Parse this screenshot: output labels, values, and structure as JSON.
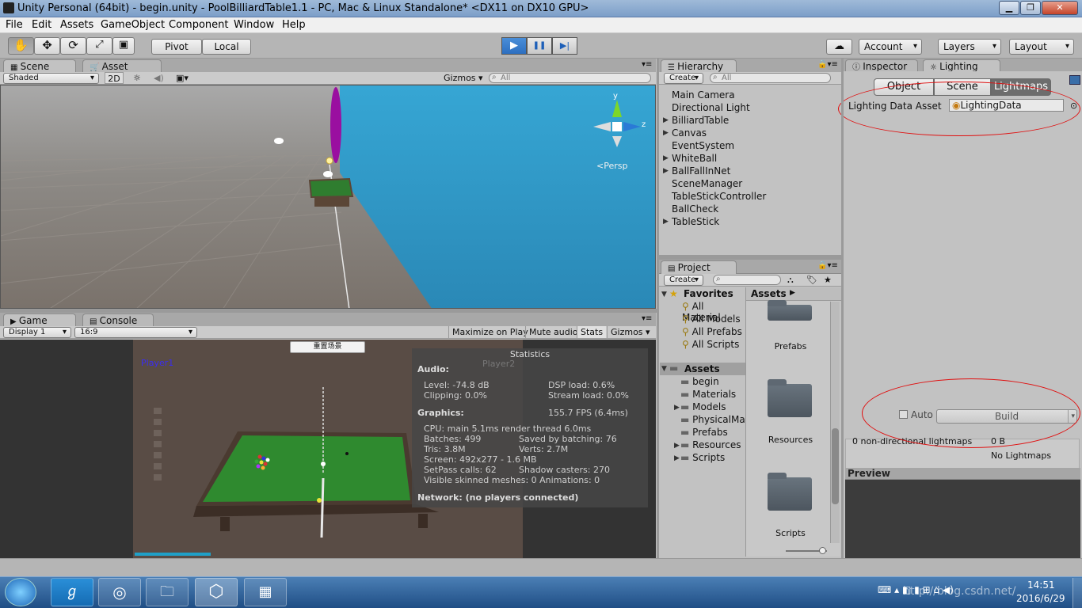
{
  "window": {
    "title": "Unity Personal (64bit) - begin.unity - PoolBilliardTable1.1 - PC, Mac & Linux Standalone* <DX11 on DX10 GPU>",
    "minimize": "▁",
    "maximize": "❐",
    "close": "✕"
  },
  "menu": [
    "File",
    "Edit",
    "Assets",
    "GameObject",
    "Component",
    "Window",
    "Help"
  ],
  "toolbar": {
    "tools": [
      "hand-icon",
      "move-icon",
      "rotate-icon",
      "scale-icon",
      "rect-icon"
    ],
    "pivot": "Pivot",
    "local": "Local",
    "play": "▶",
    "pause": "❚❚",
    "step": "▶|",
    "account": "Account",
    "layers": "Layers",
    "layout": "Layout"
  },
  "scene": {
    "tab": "Scene",
    "asset_store_tab": "Asset Store",
    "shading": "Shaded",
    "mode_2d": "2D",
    "gizmos": "Gizmos",
    "search_placeholder": "All",
    "persp": "Persp",
    "axis_y": "y",
    "axis_z": "z"
  },
  "game": {
    "tab": "Game",
    "console_tab": "Console",
    "display": "Display 1",
    "aspect": "16:9",
    "maximize_on_play": "Maximize on Play",
    "mute_audio": "Mute audio",
    "stats": "Stats",
    "gizmos": "Gizmos",
    "reset_button": "重置场景",
    "player1": "Player1",
    "player2": "Player2"
  },
  "statistics": {
    "title": "Statistics",
    "audio_label": "Audio:",
    "level": "Level: -74.8 dB",
    "clipping": "Clipping: 0.0%",
    "dsp_load": "DSP load: 0.6%",
    "stream_load": "Stream load: 0.0%",
    "graphics_label": "Graphics:",
    "fps": "155.7 FPS (6.4ms)",
    "cpu": "CPU: main 5.1ms  render thread 6.0ms",
    "batches": "Batches: 499",
    "saved_batching": "Saved by batching: 76",
    "tris": "Tris: 3.8M",
    "verts": "Verts: 2.7M",
    "screen": "Screen: 492x277 - 1.6 MB",
    "setpass": "SetPass calls: 62",
    "shadow_casters": "Shadow casters: 270",
    "skinned": "Visible skinned meshes: 0  Animations: 0",
    "network": "Network: (no players connected)"
  },
  "hierarchy": {
    "tab": "Hierarchy",
    "create": "Create",
    "search_placeholder": "All",
    "items": [
      "Main Camera",
      "Directional Light",
      "BilliardTable",
      "Canvas",
      "EventSystem",
      "WhiteBall",
      "BallFallInNet",
      "SceneManager",
      "TableStickController",
      "BallCheck",
      "TableStick"
    ]
  },
  "project": {
    "tab": "Project",
    "create": "Create",
    "favorites": "Favorites",
    "favorite_items": [
      "All Material",
      "All Models",
      "All Prefabs",
      "All Scripts"
    ],
    "assets": "Assets",
    "asset_folders": [
      "begin",
      "Materials",
      "Models",
      "PhysicalMat",
      "Prefabs",
      "Resources",
      "Scripts"
    ],
    "breadcrumb": "Assets",
    "grid_folders": [
      "Prefabs",
      "Resources",
      "Scripts"
    ]
  },
  "inspector": {
    "inspector_tab": "Inspector",
    "lighting_tab": "Lighting",
    "seg_object": "Object",
    "seg_scene": "Scene",
    "seg_lightmaps": "Lightmaps",
    "lighting_data_asset_label": "Lighting Data Asset",
    "lighting_data_asset_value": "LightingData",
    "auto_label": "Auto",
    "build_label": "Build",
    "lightmaps_count": "0 non-directional lightmaps",
    "lightmaps_size": "0 B",
    "no_lightmaps": "No Lightmaps",
    "preview": "Preview"
  },
  "taskbar": {
    "time": "14:51",
    "date": "2016/6/29",
    "watermark": "http://blog.csdn.net/"
  },
  "colors": {
    "ring": "#e01010",
    "sky": "#2f9fcd",
    "felt": "#2f7d2f",
    "magenta": "#9a0fa0",
    "player1": "#3b2cf0"
  }
}
